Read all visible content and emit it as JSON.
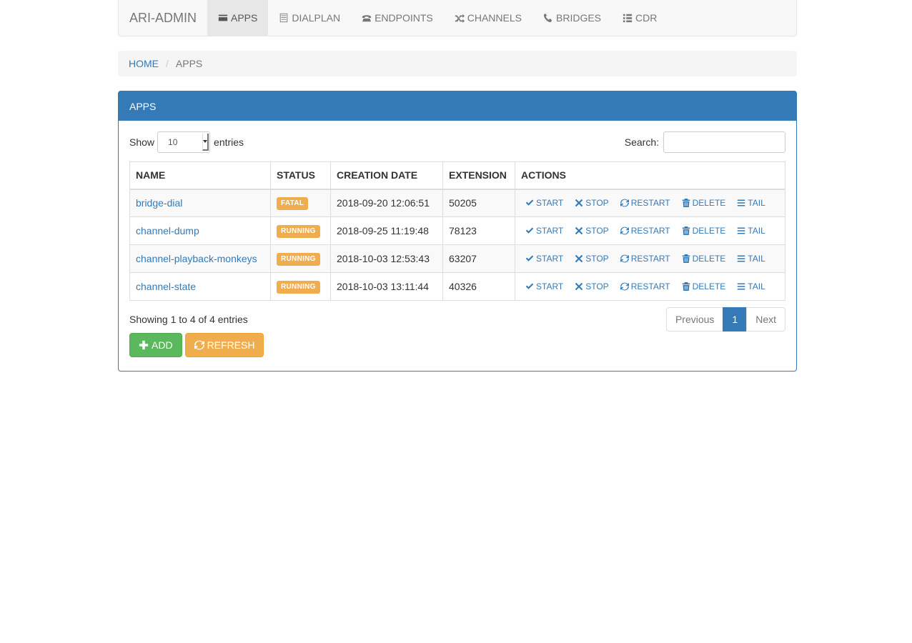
{
  "navbar": {
    "brand": "ARI-ADMIN",
    "items": [
      {
        "label": "APPS",
        "icon": "credit-card-icon",
        "active": true
      },
      {
        "label": "DIALPLAN",
        "icon": "list-alt-icon"
      },
      {
        "label": "ENDPOINTS",
        "icon": "phone-alt-icon"
      },
      {
        "label": "CHANNELS",
        "icon": "random-icon"
      },
      {
        "label": "BRIDGES",
        "icon": "phone-icon"
      },
      {
        "label": "CDR",
        "icon": "list-icon"
      }
    ]
  },
  "breadcrumb": {
    "home": "HOME",
    "current": "APPS"
  },
  "panel": {
    "title": "APPS",
    "show_label": "Show",
    "entries_label": "entries",
    "page_length": "10",
    "search_label": "Search:",
    "search_value": "",
    "columns": [
      "NAME",
      "STATUS",
      "CREATION DATE",
      "EXTENSION",
      "ACTIONS"
    ],
    "rows": [
      {
        "name": "bridge-dial",
        "status": "FATAL",
        "created": "2018-09-20 12:06:51",
        "extension": "50205"
      },
      {
        "name": "channel-dump",
        "status": "RUNNING",
        "created": "2018-09-25 11:19:48",
        "extension": "78123"
      },
      {
        "name": "channel-playback-monkeys",
        "status": "RUNNING",
        "created": "2018-10-03 12:53:43",
        "extension": "63207"
      },
      {
        "name": "channel-state",
        "status": "RUNNING",
        "created": "2018-10-03 13:11:44",
        "extension": "40326"
      }
    ],
    "actions": [
      "START",
      "STOP",
      "RESTART",
      "DELETE",
      "TAIL"
    ],
    "info": "Showing 1 to 4 of 4 entries",
    "pager": {
      "previous": "Previous",
      "page": "1",
      "next": "Next"
    },
    "buttons": {
      "add": "ADD",
      "refresh": "REFRESH"
    }
  },
  "colors": {
    "primary": "#337ab7",
    "warning": "#f0ad4e",
    "success": "#5cb85c"
  }
}
